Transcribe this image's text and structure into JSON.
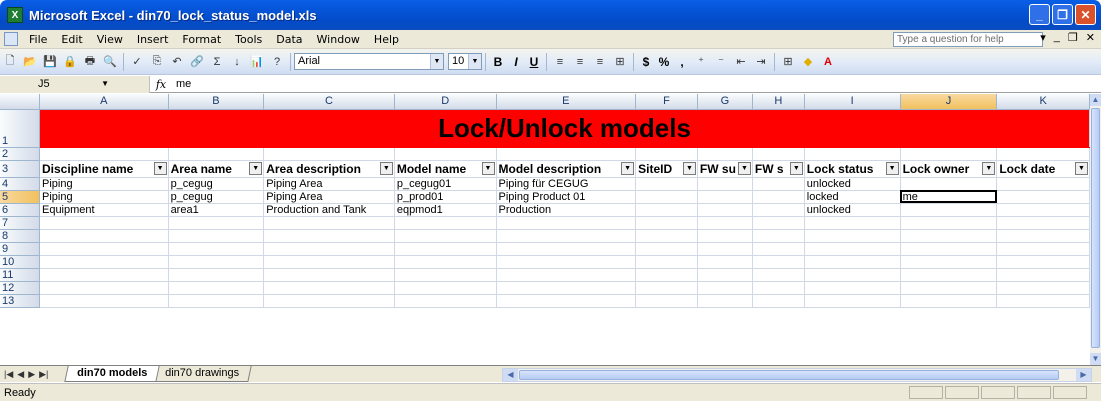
{
  "window": {
    "title": "Microsoft Excel - din70_lock_status_model.xls"
  },
  "menu": {
    "items": [
      "File",
      "Edit",
      "View",
      "Insert",
      "Format",
      "Tools",
      "Data",
      "Window",
      "Help"
    ],
    "help_placeholder": "Type a question for help"
  },
  "toolbar": {
    "font_name": "Arial",
    "font_size": "10"
  },
  "formula": {
    "cell_ref": "J5",
    "fx": "fx",
    "value": "me"
  },
  "columns": [
    "A",
    "B",
    "C",
    "D",
    "E",
    "F",
    "G",
    "H",
    "I",
    "J",
    "K"
  ],
  "active_column": "J",
  "active_row": 5,
  "banner": "Lock/Unlock models",
  "headers": [
    "Discipline name",
    "Area name",
    "Area description",
    "Model name",
    "Model description",
    "SiteID",
    "FW su",
    "FW s",
    "Lock status",
    "Lock owner",
    "Lock date"
  ],
  "rows": [
    [
      "Piping",
      "p_cegug",
      "Piping Area",
      "p_cegug01",
      "Piping für CEGUG",
      "",
      "",
      "",
      "unlocked",
      "",
      ""
    ],
    [
      "Piping",
      "p_cegug",
      "Piping Area",
      "p_prod01",
      "Piping Product 01",
      "",
      "",
      "",
      "locked",
      "me",
      ""
    ],
    [
      "Equipment",
      "area1",
      "Production and Tank",
      "eqpmod1",
      "Production",
      "",
      "",
      "",
      "unlocked",
      "",
      ""
    ]
  ],
  "row_numbers": [
    "1",
    "2",
    "3",
    "4",
    "5",
    "6",
    "7",
    "8",
    "9",
    "10",
    "11",
    "12",
    "13"
  ],
  "sheets": {
    "active": "din70 models",
    "other": "din70 drawings"
  },
  "status": {
    "text": "Ready"
  }
}
